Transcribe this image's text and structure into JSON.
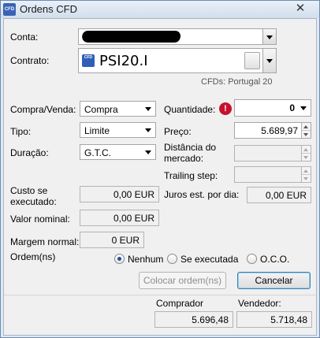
{
  "window": {
    "title": "Ordens CFD",
    "close_symbol": "✕",
    "icon_text": "CFD"
  },
  "account": {
    "label": "Conta:"
  },
  "contract": {
    "label": "Contrato:",
    "value": "PSI20.I",
    "icon_text": "CFD",
    "subtitle": "CFDs: Portugal 20"
  },
  "order": {
    "side_label": "Compra/Venda:",
    "side_value": "Compra",
    "type_label": "Tipo:",
    "type_value": "Limite",
    "duration_label": "Duração:",
    "duration_value": "G.T.C.",
    "quantity_label": "Quantidade:",
    "quantity_value": "0",
    "price_label": "Preço:",
    "price_value": "5.689,97",
    "market_distance_label_1": "Distância do",
    "market_distance_label_2": "mercado:",
    "trailing_step_label": "Trailing step:"
  },
  "costs": {
    "executed_cost_label_1": "Custo se",
    "executed_cost_label_2": "executado:",
    "executed_cost_value": "0,00 EUR",
    "nominal_label": "Valor nominal:",
    "nominal_value": "0,00 EUR",
    "margin_label": "Margem normal:",
    "margin_value": "0 EUR",
    "interest_label": "Juros est. por dia:",
    "interest_value": "0,00 EUR"
  },
  "orders_section": {
    "label": "Ordem(ns)",
    "options": [
      "Nenhum",
      "Se executada",
      "O.C.O."
    ],
    "selected": "Nenhum"
  },
  "buttons": {
    "place": "Colocar ordem(ns)",
    "cancel": "Cancelar"
  },
  "quotes": {
    "buyer_label": "Comprador",
    "buyer_value": "5.696,48",
    "seller_label": "Vendedor:",
    "seller_value": "5.718,48"
  },
  "icons": {
    "app": "cfd-app-icon",
    "close": "close-icon",
    "warning": "warning-icon",
    "contract": "cfd-contract-icon",
    "browse": "contract-browser-icon"
  },
  "colors": {
    "warning": "#c8102e",
    "accent": "#2f5eb7",
    "window_frame": "#6d8bb0"
  }
}
